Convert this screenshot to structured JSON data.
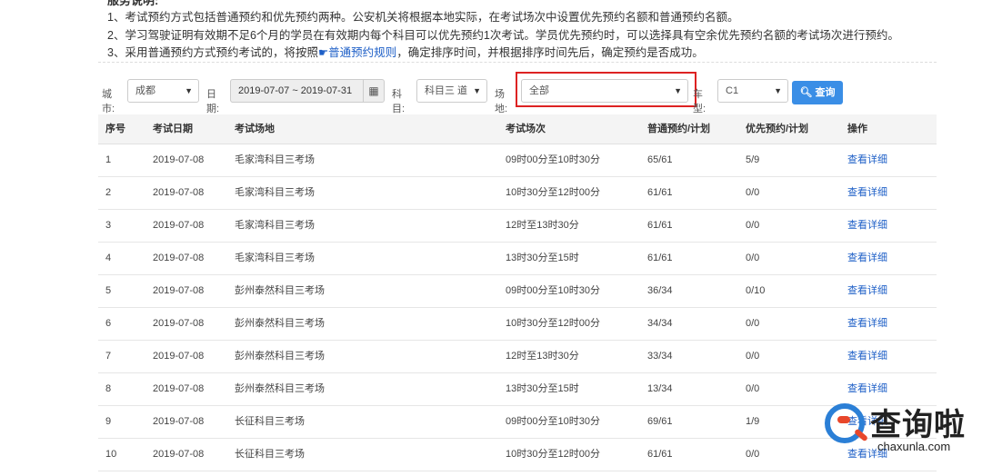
{
  "notice": {
    "header": "服务说明:",
    "lines": [
      "1、考试预约方式包括普通预约和优先预约两种。公安机关将根据本地实际，在考试场次中设置优先预约名额和普通预约名额。",
      "2、学习驾驶证明有效期不足6个月的学员在有效期内每个科目可以优先预约1次考试。学员优先预约时，可以选择具有空余优先预约名额的考试场次进行预约。"
    ],
    "line3_prefix": "3、采用普通预约方式预约考试的，将按照",
    "line3_link": "普通预约规则",
    "line3_suffix": "，确定排序时间，并根据排序时间先后，确定预约是否成功。"
  },
  "filters": {
    "city_label": "城市:",
    "city_value": "成都",
    "date_label": "日期:",
    "date_value": "2019-07-07 ~ 2019-07-31",
    "subject_label": "科目:",
    "subject_value": "科目三 道",
    "venue_label": "场地:",
    "venue_value": "全部",
    "cartype_label": "车型:",
    "cartype_value": "C1",
    "query_button": "查询"
  },
  "table": {
    "headers": [
      "序号",
      "考试日期",
      "考试场地",
      "考试场次",
      "普通预约/计划",
      "优先预约/计划",
      "操作"
    ],
    "rows": [
      [
        "1",
        "2019-07-08",
        "毛家湾科目三考场",
        "09时00分至10时30分",
        "65/61",
        "5/9",
        "查看详细"
      ],
      [
        "2",
        "2019-07-08",
        "毛家湾科目三考场",
        "10时30分至12时00分",
        "61/61",
        "0/0",
        "查看详细"
      ],
      [
        "3",
        "2019-07-08",
        "毛家湾科目三考场",
        "12时至13时30分",
        "61/61",
        "0/0",
        "查看详细"
      ],
      [
        "4",
        "2019-07-08",
        "毛家湾科目三考场",
        "13时30分至15时",
        "61/61",
        "0/0",
        "查看详细"
      ],
      [
        "5",
        "2019-07-08",
        "彭州泰然科目三考场",
        "09时00分至10时30分",
        "36/34",
        "0/10",
        "查看详细"
      ],
      [
        "6",
        "2019-07-08",
        "彭州泰然科目三考场",
        "10时30分至12时00分",
        "34/34",
        "0/0",
        "查看详细"
      ],
      [
        "7",
        "2019-07-08",
        "彭州泰然科目三考场",
        "12时至13时30分",
        "33/34",
        "0/0",
        "查看详细"
      ],
      [
        "8",
        "2019-07-08",
        "彭州泰然科目三考场",
        "13时30分至15时",
        "13/34",
        "0/0",
        "查看详细"
      ],
      [
        "9",
        "2019-07-08",
        "长征科目三考场",
        "09时00分至10时30分",
        "69/61",
        "1/9",
        "查看详细"
      ],
      [
        "10",
        "2019-07-08",
        "长征科目三考场",
        "10时30分至12时00分",
        "61/61",
        "0/0",
        "查看详细"
      ]
    ]
  },
  "watermark": {
    "cn": "查询啦",
    "en": "chaxunla.com"
  },
  "colors": {
    "link": "#1e5fc7",
    "button": "#3a8ee6",
    "highlight": "#dd2222"
  }
}
